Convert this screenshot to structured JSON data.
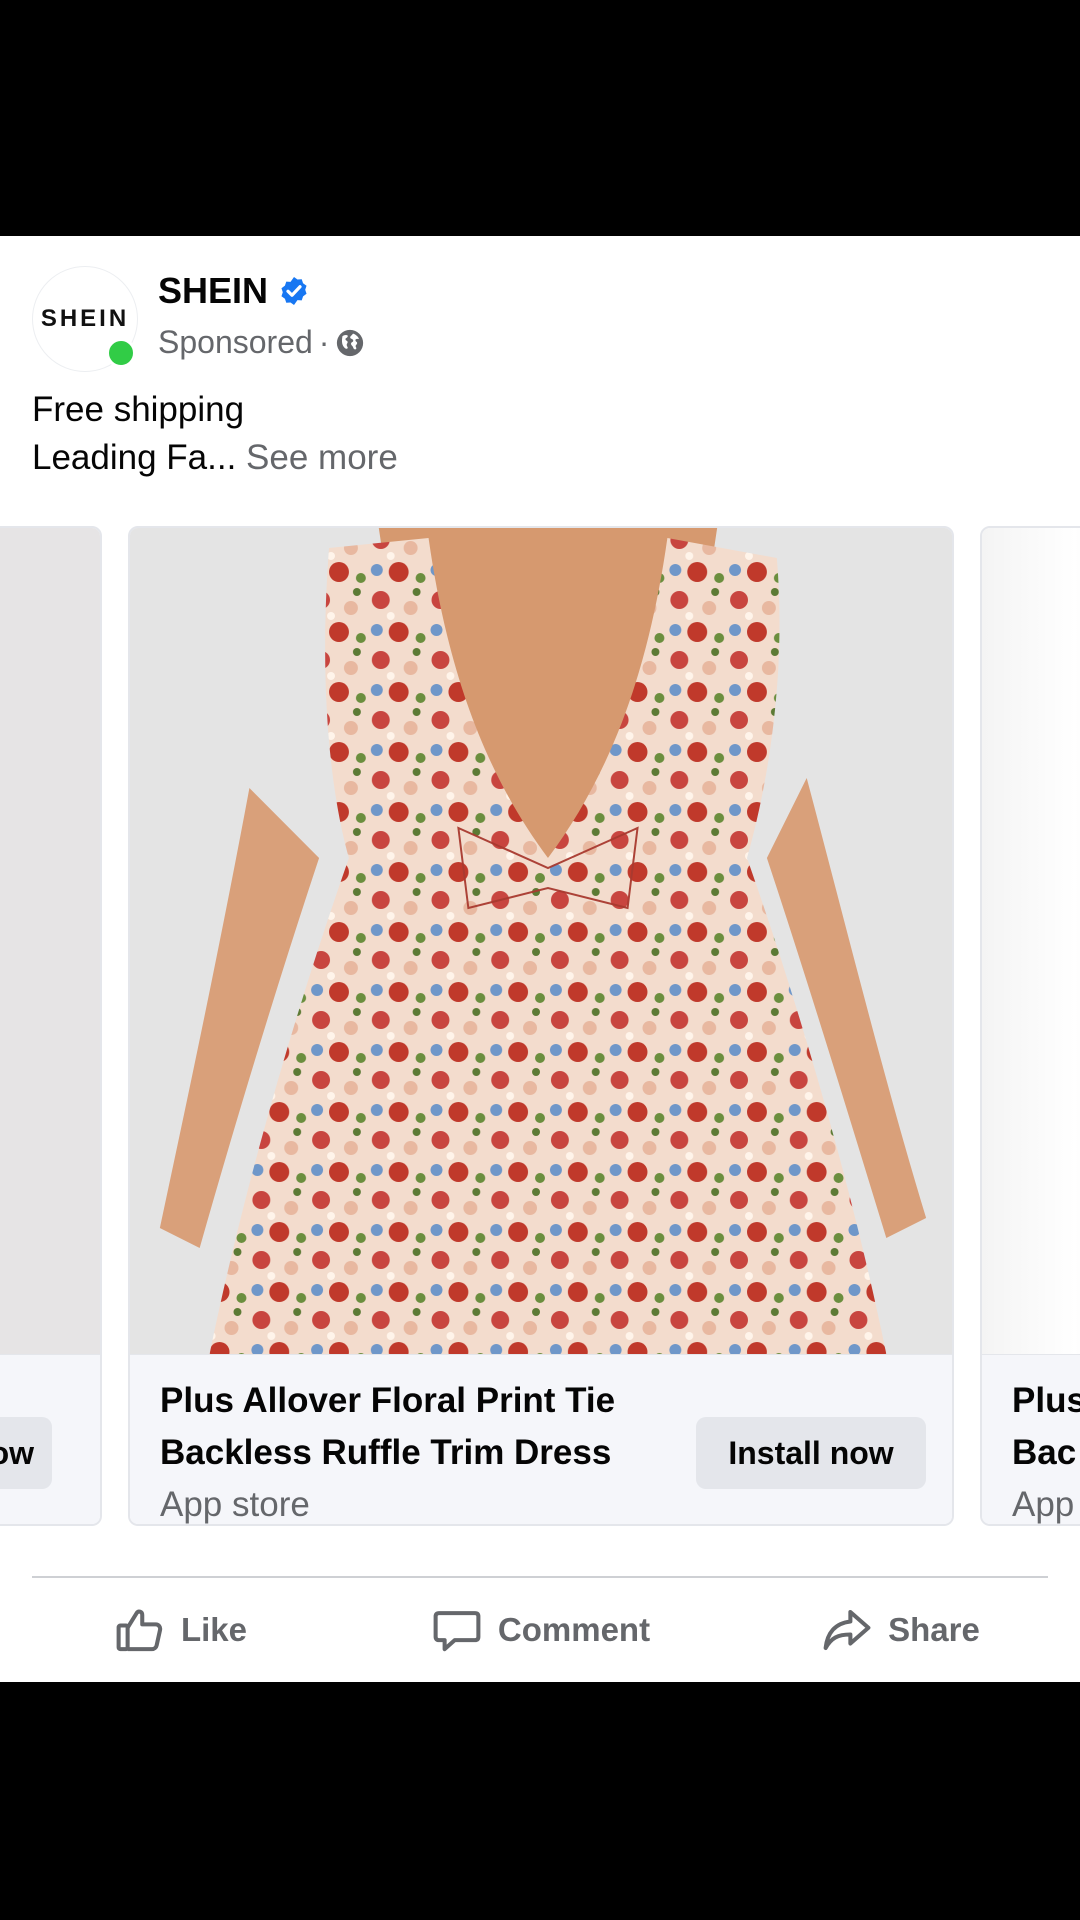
{
  "post": {
    "page_name": "SHEIN",
    "avatar_text": "SHEIN",
    "sponsored": "Sponsored",
    "separator": "·",
    "caption_line1": "Free shipping",
    "caption_line2": "Leading Fa...",
    "see_more": "See more"
  },
  "carousel": {
    "left_card": {
      "cta_partial": "ow"
    },
    "main_card": {
      "title": "Plus Allover Floral Print Tie Backless Ruffle Trim Dress",
      "source": "App store",
      "cta": "Install now"
    },
    "right_card": {
      "title_partial_1": "Plus",
      "title_partial_2": "Bac",
      "source_partial": "App"
    }
  },
  "actions": {
    "like": "Like",
    "comment": "Comment",
    "share": "Share"
  },
  "colors": {
    "verified_blue": "#1877f2",
    "online_green": "#31cc46",
    "muted_text": "#65676b",
    "button_bg": "#e4e6eb"
  }
}
